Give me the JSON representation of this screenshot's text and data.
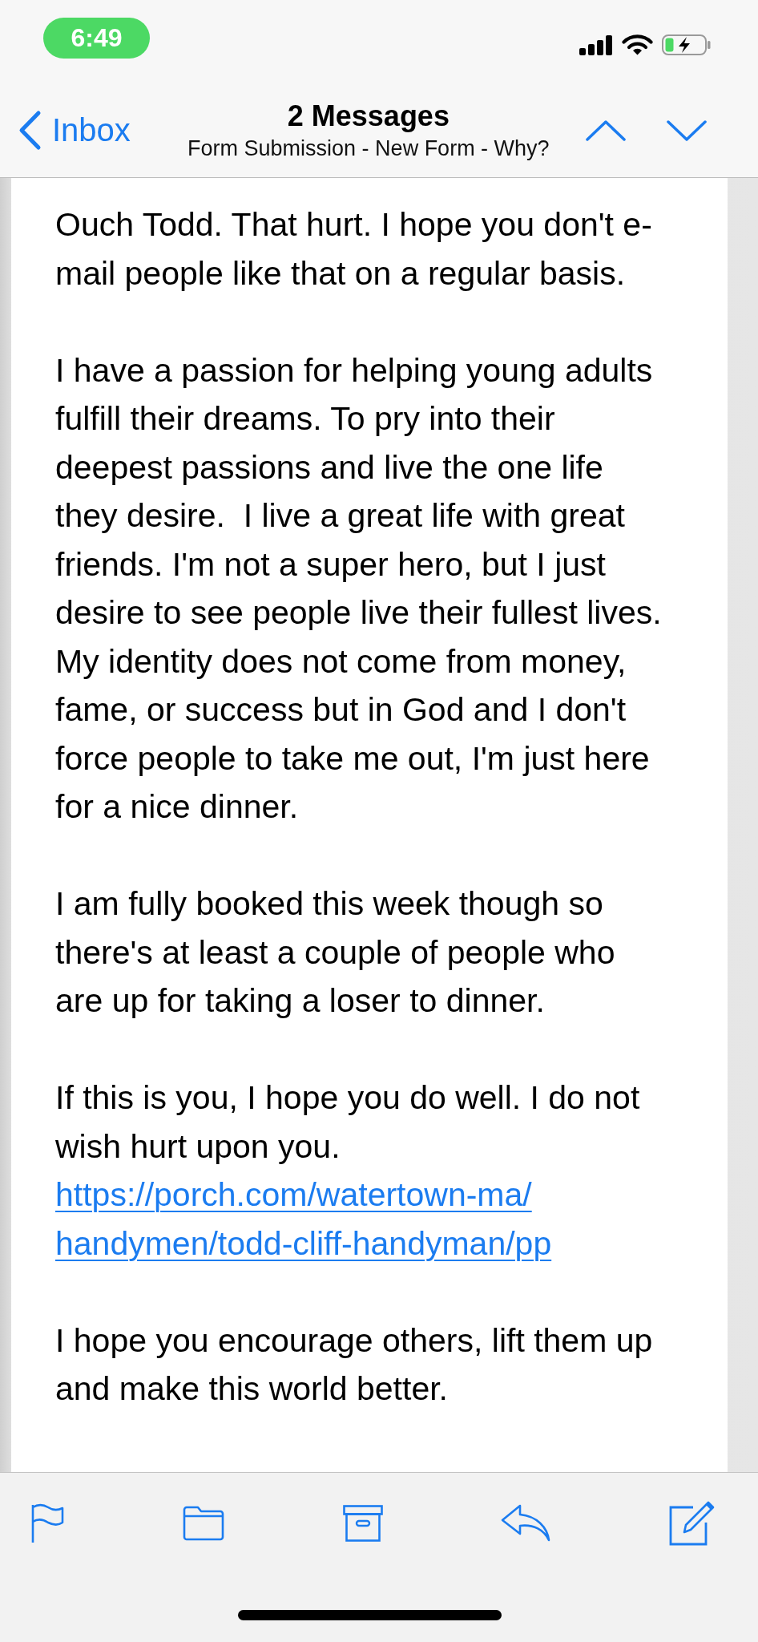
{
  "status_bar": {
    "time": "6:49"
  },
  "nav": {
    "back_label": "Inbox",
    "title": "2 Messages",
    "subtitle": "Form Submission - New Form - Why?"
  },
  "message": {
    "paragraphs": [
      {
        "parts": [
          {
            "kind": "text",
            "text": "Ouch Todd. That hurt. I hope you don't e-\nmail people like that on a regular basis."
          }
        ]
      },
      {
        "parts": [
          {
            "kind": "text",
            "text": "I have a passion for helping young adults\nfulfill their dreams. To pry into their\ndeepest passions and live the one life\nthey desire.  I live a great life with great\nfriends. I'm not a super hero, but I just\ndesire to see people live their fullest lives.\nMy identity does not come from money,\nfame, or success but in God and I don't\nforce people to take me out, I'm just here\nfor a nice dinner."
          }
        ]
      },
      {
        "parts": [
          {
            "kind": "text",
            "text": "I am fully booked this week though so\nthere's at least a couple of people who\nare up for taking a loser to dinner."
          }
        ]
      },
      {
        "parts": [
          {
            "kind": "text",
            "text": "If this is you, I hope you do well. I do not\nwish hurt upon you."
          },
          {
            "kind": "link",
            "text": "https://porch.com/watertown-ma/\nhandymen/todd-cliff-handyman/pp"
          }
        ]
      },
      {
        "parts": [
          {
            "kind": "text",
            "text": "I hope you encourage others, lift them up\nand make this world better."
          }
        ]
      }
    ]
  }
}
